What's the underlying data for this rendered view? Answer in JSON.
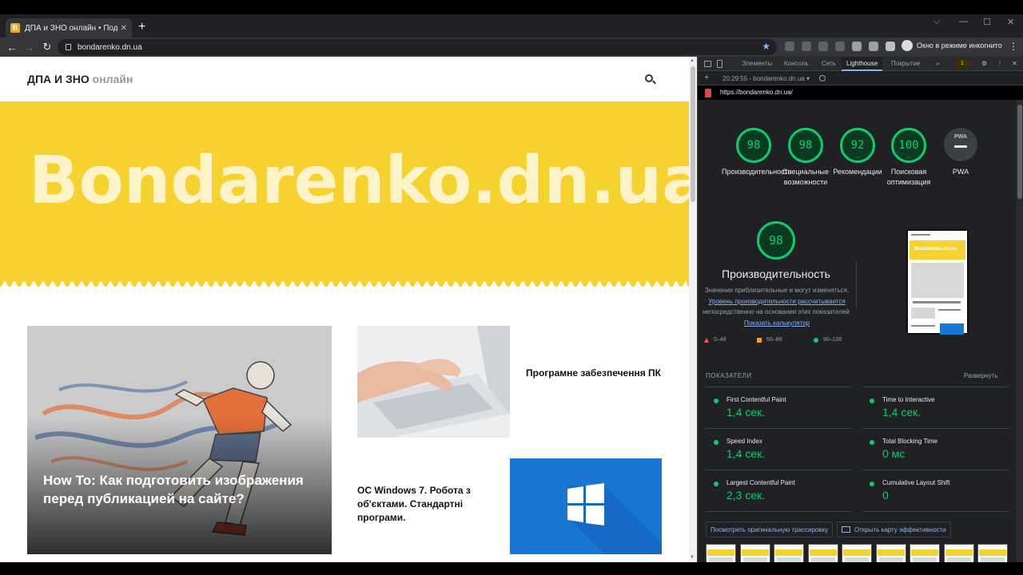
{
  "browser": {
    "tab_title": "ДПА и ЗНО онлайн • Подготовка",
    "tab_favicon": "B",
    "url": "bondarenko.dn.ua",
    "incognito_label": "Окно в режиме инкогнито"
  },
  "site": {
    "logo_main": "ДПА И ЗНО",
    "logo_accent": "онлайн",
    "hero_title": "Bondarenko.dn.ua",
    "featured_title": "How To: Как подготовить изображения перед публикацией на сайте?",
    "post1_title": "Програмне забезпечення ПК",
    "post2_title": "ОС Windows 7. Робота з об'єктами. Стандартні програми."
  },
  "devtools": {
    "tabs": [
      "Элементы",
      "Консоль",
      "Сеть",
      "Lighthouse",
      "Покрытие"
    ],
    "more_tabs": "»",
    "warning_count": "1",
    "run_label": "20:29:55 - bondarenko.dn.ua",
    "report_url": "https://bondarenko.dn.ua/",
    "scores": [
      {
        "value": "98",
        "label": "Производительность"
      },
      {
        "value": "98",
        "label": "Специальные возможности"
      },
      {
        "value": "92",
        "label": "Рекомендации"
      },
      {
        "value": "100",
        "label": "Поисковая оптимизация"
      }
    ],
    "pwa_badge": "PWA",
    "pwa_label": "PWA",
    "perf_score": "98",
    "perf_title": "Производительность",
    "perf_note_1": "Значения приблизительные и могут изменяться.",
    "perf_note_link": "Уровень производительности рассчитывается",
    "perf_note_2": "непосредственно на основании этих показателей.",
    "perf_note_calc": "Показать калькулятор",
    "legend": [
      "0–49",
      "50–89",
      "90–100"
    ],
    "metrics_header": "ПОКАЗАТЕЛИ",
    "expand": "Развернуть",
    "metrics": [
      {
        "name": "First Contentful Paint",
        "value": "1,4 сек."
      },
      {
        "name": "Time to Interactive",
        "value": "1,4 сек."
      },
      {
        "name": "Speed Index",
        "value": "1,4 сек."
      },
      {
        "name": "Total Blocking Time",
        "value": "0 мс"
      },
      {
        "name": "Largest Contentful Paint",
        "value": "2,3 сек."
      },
      {
        "name": "Cumulative Layout Shift",
        "value": "0"
      }
    ],
    "trace_button": "Посмотреть оригинальную трассировку",
    "treemap_button": "Открыть карту эффективности",
    "phone_hero": "Bondarenko.dn.ua"
  },
  "colors": {
    "pass": "#0cce6b",
    "hero_yellow": "#f6d22e",
    "windows_blue": "#1976d2"
  }
}
